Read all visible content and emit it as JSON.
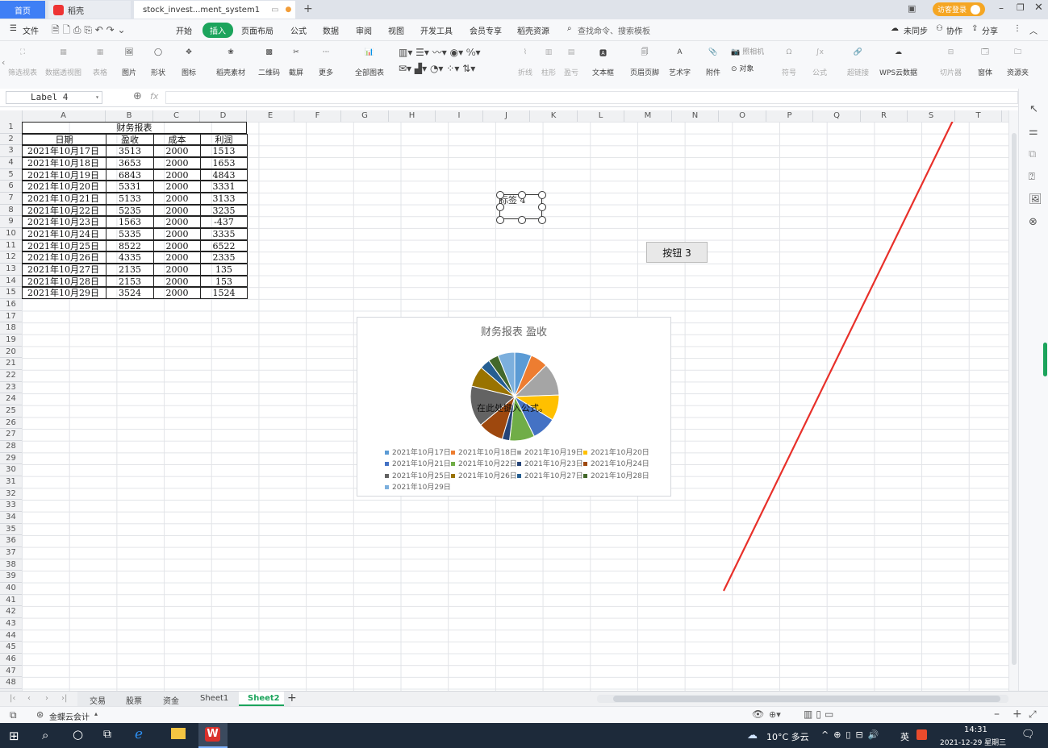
{
  "tabs": [
    {
      "label": "首页"
    },
    {
      "label": "稻壳"
    },
    {
      "label": "stock_invest...ment_system1"
    }
  ],
  "titlebar": {
    "login_label": "访客登录"
  },
  "menu": {
    "file_label": "文件",
    "items": [
      "开始",
      "插入",
      "页面布局",
      "公式",
      "数据",
      "审阅",
      "视图",
      "开发工具",
      "会员专享",
      "稻壳资源"
    ],
    "active_item": "插入",
    "search_placeholder": "查找命令、搜索模板",
    "right": [
      "未同步",
      "协作",
      "分享"
    ]
  },
  "ribbon": {
    "items": [
      "筛选视表",
      "数据透视图",
      "表格",
      "图片",
      "形状",
      "图标",
      "稻壳素材",
      "二维码",
      "截屏",
      "更多",
      "全部图表",
      "折线",
      "柱形",
      "盈亏",
      "文本框",
      "页眉页脚",
      "艺术字",
      "附件",
      "照相机",
      "对象",
      "符号",
      "公式",
      "超链接",
      "WPS云数据",
      "切片器",
      "窗体",
      "资源夹"
    ]
  },
  "formula": {
    "name_box": "Label 4",
    "fx": "fx"
  },
  "columns": [
    "A",
    "B",
    "C",
    "D",
    "E",
    "F",
    "G",
    "H",
    "I",
    "J",
    "K",
    "L",
    "M",
    "N",
    "O",
    "P",
    "Q",
    "R",
    "S",
    "T"
  ],
  "rows": [
    "1",
    "2",
    "3",
    "4",
    "5",
    "6",
    "7",
    "8",
    "9",
    "10",
    "11",
    "12",
    "13",
    "14",
    "15",
    "16",
    "17",
    "18",
    "19",
    "20",
    "21",
    "22",
    "23",
    "24",
    "25",
    "26",
    "27",
    "28",
    "29",
    "30",
    "31",
    "32",
    "33",
    "34",
    "35",
    "36",
    "37",
    "38",
    "39",
    "40",
    "41",
    "42",
    "43",
    "44",
    "45",
    "46",
    "47",
    "48"
  ],
  "table": {
    "title": "财务报表",
    "headers": [
      "日期",
      "盈收",
      "成本",
      "利润"
    ],
    "rows": [
      [
        "2021年10月17日",
        "3513",
        "2000",
        "1513"
      ],
      [
        "2021年10月18日",
        "3653",
        "2000",
        "1653"
      ],
      [
        "2021年10月19日",
        "6843",
        "2000",
        "4843"
      ],
      [
        "2021年10月20日",
        "5331",
        "2000",
        "3331"
      ],
      [
        "2021年10月21日",
        "5133",
        "2000",
        "3133"
      ],
      [
        "2021年10月22日",
        "5235",
        "2000",
        "3235"
      ],
      [
        "2021年10月23日",
        "1563",
        "2000",
        "-437"
      ],
      [
        "2021年10月24日",
        "5335",
        "2000",
        "3335"
      ],
      [
        "2021年10月25日",
        "8522",
        "2000",
        "6522"
      ],
      [
        "2021年10月26日",
        "4335",
        "2000",
        "2335"
      ],
      [
        "2021年10月27日",
        "2135",
        "2000",
        "135"
      ],
      [
        "2021年10月28日",
        "2153",
        "2000",
        "153"
      ],
      [
        "2021年10月29日",
        "3524",
        "2000",
        "1524"
      ]
    ]
  },
  "controls": {
    "label": "标签 4",
    "button": "按钮 3"
  },
  "chart_data": {
    "type": "pie",
    "title": "财务报表 盈收",
    "overlay_text": "在此处键入公式。",
    "categories": [
      "2021年10月17日",
      "2021年10月18日",
      "2021年10月19日",
      "2021年10月20日",
      "2021年10月21日",
      "2021年10月22日",
      "2021年10月23日",
      "2021年10月24日",
      "2021年10月25日",
      "2021年10月26日",
      "2021年10月27日",
      "2021年10月28日",
      "2021年10月29日"
    ],
    "values": [
      3513,
      3653,
      6843,
      5331,
      5133,
      5235,
      1563,
      5335,
      8522,
      4335,
      2135,
      2153,
      3524
    ],
    "colors": [
      "#5b9bd5",
      "#ed7d31",
      "#a5a5a5",
      "#ffc000",
      "#4472c4",
      "#70ad47",
      "#264478",
      "#9e480e",
      "#636363",
      "#997300",
      "#255e91",
      "#43682b",
      "#7cafdd"
    ],
    "legend": "bottom"
  },
  "sheets": {
    "names": [
      "交易",
      "股票",
      "资金",
      "Sheet1",
      "Sheet2"
    ],
    "active": "Sheet2"
  },
  "status": {
    "plugin": "金蝶云会计"
  },
  "taskbar": {
    "weather": "10°C 多云",
    "lang": "英",
    "time": "14:31",
    "date": "2021-12-29 星期三"
  }
}
